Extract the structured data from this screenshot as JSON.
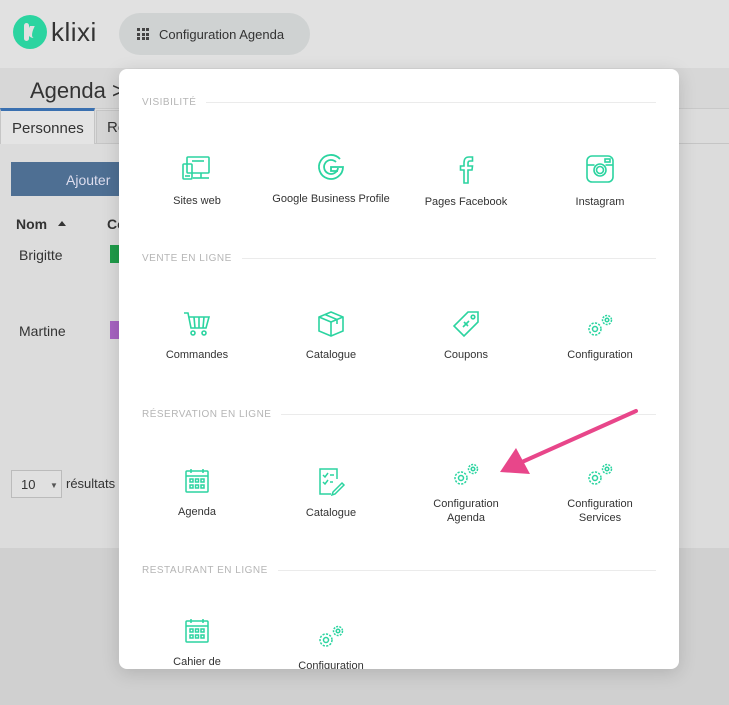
{
  "topbar": {
    "logo_text": "klixi",
    "menu_button_label": "Configuration Agenda"
  },
  "background": {
    "page_title": "Agenda >",
    "tabs": [
      "Personnes",
      "Re"
    ],
    "add_button_label": "Ajouter",
    "columns": [
      "Nom",
      "Co"
    ],
    "rows": [
      {
        "name": "Brigitte",
        "color": "#1f9c4a"
      },
      {
        "name": "Martine",
        "color": "#a763c2"
      }
    ],
    "pager_value": "10",
    "pager_text": "résultats"
  },
  "modal": {
    "accent_color": "#2bd4a0",
    "sections": [
      {
        "label": "Visibilité",
        "items": [
          {
            "label": "Sites web",
            "icon": "devices-icon"
          },
          {
            "label": "Google Business Profile",
            "icon": "google-icon"
          },
          {
            "label": "Pages Facebook",
            "icon": "facebook-icon"
          },
          {
            "label": "Instagram",
            "icon": "instagram-icon"
          }
        ]
      },
      {
        "label": "Vente en ligne",
        "items": [
          {
            "label": "Commandes",
            "icon": "cart-icon"
          },
          {
            "label": "Catalogue",
            "icon": "box-icon"
          },
          {
            "label": "Coupons",
            "icon": "coupon-icon"
          },
          {
            "label": "Configuration",
            "icon": "gears-icon"
          }
        ]
      },
      {
        "label": "Réservation en ligne",
        "items": [
          {
            "label": "Agenda",
            "icon": "calendar-icon"
          },
          {
            "label": "Catalogue",
            "icon": "checklist-icon"
          },
          {
            "label": "Configuration Agenda",
            "icon": "gears-icon"
          },
          {
            "label": "Configuration Services",
            "icon": "gears-icon"
          }
        ]
      },
      {
        "label": "Restaurant en ligne",
        "items": [
          {
            "label": "Cahier de",
            "icon": "calendar-icon"
          },
          {
            "label": "Configuration",
            "icon": "gears-icon"
          }
        ]
      }
    ]
  },
  "annotation": {
    "arrow_color": "#e8468a"
  }
}
